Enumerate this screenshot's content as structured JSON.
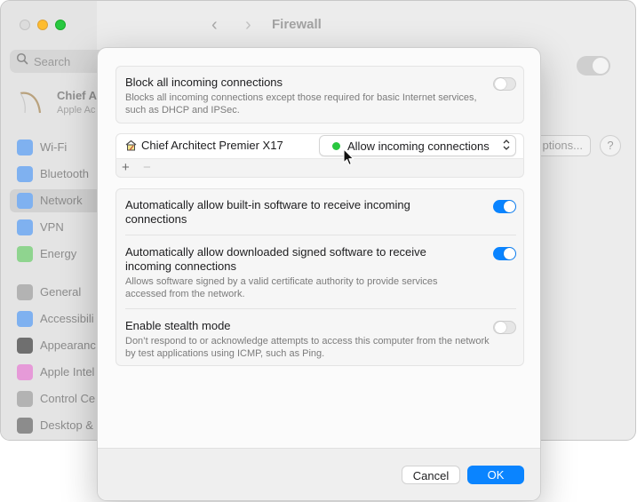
{
  "background_window": {
    "title": "Firewall",
    "search_placeholder": "Search",
    "account": {
      "name": "Chief A",
      "subtitle": "Apple Ac"
    },
    "sidebar_items": [
      {
        "label": "Wi-Fi",
        "icon": "wifi-icon",
        "color": "#7fb1f0",
        "selected": false
      },
      {
        "label": "Bluetooth",
        "icon": "bluetooth-icon",
        "color": "#7fb1f0",
        "selected": false
      },
      {
        "label": "Network",
        "icon": "network-icon",
        "color": "#7fb1f0",
        "selected": true
      },
      {
        "label": "VPN",
        "icon": "vpn-icon",
        "color": "#7fb1f0",
        "selected": false
      },
      {
        "label": "Energy",
        "icon": "energy-icon",
        "color": "#8fd48f",
        "selected": false
      },
      {
        "label": "General",
        "icon": "gear-icon",
        "color": "#b3b3b3",
        "selected": false
      },
      {
        "label": "Accessibili",
        "icon": "accessibility-icon",
        "color": "#7fb1f0",
        "selected": false
      },
      {
        "label": "Appearanc",
        "icon": "appearance-icon",
        "color": "#6f6f6f",
        "selected": false
      },
      {
        "label": "Apple Intel",
        "icon": "apple-intelligence-icon",
        "color": "#e69ad8",
        "selected": false
      },
      {
        "label": "Control Ce",
        "icon": "control-center-icon",
        "color": "#b3b3b3",
        "selected": false
      },
      {
        "label": "Desktop &",
        "icon": "desktop-icon",
        "color": "#8c8c8c",
        "selected": false
      }
    ],
    "options_button": "ptions...",
    "help_button": "?",
    "firewall_toggle_on": true
  },
  "dialog": {
    "block_all": {
      "title": "Block all incoming connections",
      "description": "Blocks all incoming connections except those required for basic Internet services, such as DHCP and IPSec.",
      "enabled": false
    },
    "app_list": [
      {
        "name": "Chief Architect Premier X17",
        "icon": "chief-architect-app-icon",
        "status_label": "Allow incoming connections",
        "status_color": "#29c73f"
      }
    ],
    "add_label": "+",
    "remove_label": "−",
    "auto_builtin": {
      "title": "Automatically allow built-in software to receive incoming connections",
      "enabled": true
    },
    "auto_signed": {
      "title": "Automatically allow downloaded signed software to receive incoming connections",
      "description": "Allows software signed by a valid certificate authority to provide services accessed from the network.",
      "enabled": true
    },
    "stealth": {
      "title": "Enable stealth mode",
      "description": "Don’t respond to or acknowledge attempts to access this computer from the network by test applications using ICMP, such as Ping.",
      "enabled": false
    },
    "cancel_label": "Cancel",
    "ok_label": "OK",
    "accent_color": "#0a84ff"
  }
}
